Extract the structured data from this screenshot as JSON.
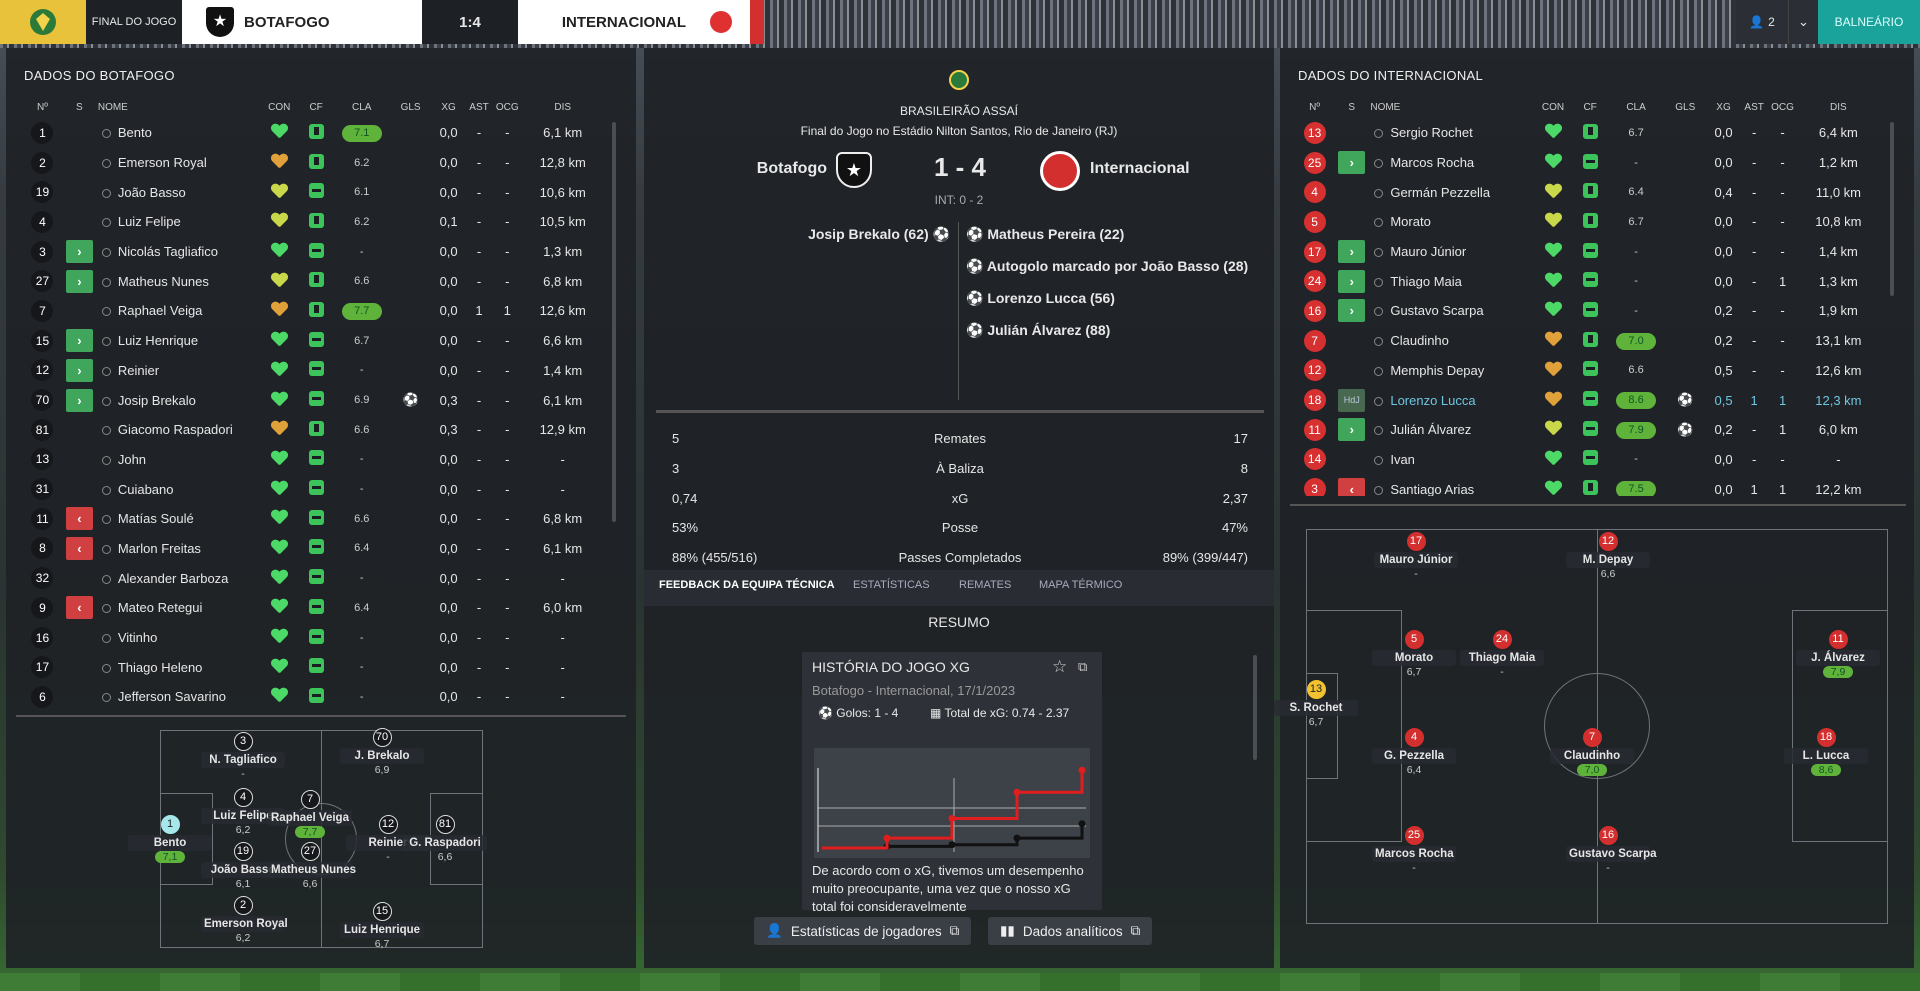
{
  "header": {
    "status": "FINAL DO JOGO",
    "home": "BOTAFOGO",
    "score": "1:4",
    "away": "INTERNACIONAL",
    "user_count": "2",
    "dressing_room": "BALNEÁRIO"
  },
  "colors": {
    "accent": "#1aa39a",
    "rating_green": "#5fb33a",
    "sub_in": "#3fa65c",
    "sub_out": "#d04040",
    "inter_red": "#d42f2f"
  },
  "icons": {
    "league": "brasileirao-icon",
    "person": "user-icon",
    "chevron": "chevron-down-icon",
    "goal": "ball-icon",
    "star": "star-icon",
    "external": "external-link-icon",
    "chart": "bar-chart-icon"
  },
  "columns": {
    "no": "Nº",
    "s": "S",
    "name": "NOME",
    "con": "CON",
    "cf": "CF",
    "cla": "CLA",
    "gls": "GLS",
    "xg": "XG",
    "ast": "AST",
    "ocg": "OCG",
    "dis": "DIS"
  },
  "botafogo": {
    "title": "DADOS DO BOTAFOGO",
    "players": [
      {
        "no": "1",
        "s": "",
        "name": "Bento",
        "con": "g",
        "cf": "u",
        "cla": "7.1",
        "cg": true,
        "gls": "",
        "xg": "0,0",
        "ast": "-",
        "ocg": "-",
        "dis": "6,1 km",
        "dim": false
      },
      {
        "no": "2",
        "s": "",
        "name": "Emerson Royal",
        "con": "o",
        "cf": "u",
        "cla": "6.2",
        "cg": false,
        "gls": "",
        "xg": "0,0",
        "ast": "-",
        "ocg": "-",
        "dis": "12,8 km",
        "dim": false
      },
      {
        "no": "19",
        "s": "",
        "name": "João Basso",
        "con": "y",
        "cf": "m",
        "cla": "6.1",
        "cg": false,
        "gls": "",
        "xg": "0,0",
        "ast": "-",
        "ocg": "-",
        "dis": "10,6 km",
        "dim": false
      },
      {
        "no": "4",
        "s": "",
        "name": "Luiz Felipe",
        "con": "y",
        "cf": "u",
        "cla": "6.2",
        "cg": false,
        "gls": "",
        "xg": "0,1",
        "ast": "-",
        "ocg": "-",
        "dis": "10,5 km",
        "dim": false
      },
      {
        "no": "3",
        "s": "in",
        "name": "Nicolás Tagliafico",
        "con": "g",
        "cf": "m",
        "cla": "-",
        "cg": false,
        "gls": "",
        "xg": "0,0",
        "ast": "-",
        "ocg": "-",
        "dis": "1,3 km",
        "dim": false
      },
      {
        "no": "27",
        "s": "in",
        "name": "Matheus Nunes",
        "con": "y",
        "cf": "u",
        "cla": "6.6",
        "cg": false,
        "gls": "",
        "xg": "0,0",
        "ast": "-",
        "ocg": "-",
        "dis": "6,8 km",
        "dim": false
      },
      {
        "no": "7",
        "s": "",
        "name": "Raphael Veiga",
        "con": "o",
        "cf": "u",
        "cla": "7.7",
        "cg": true,
        "gls": "",
        "xg": "0,0",
        "ast": "1",
        "ocg": "1",
        "dis": "12,6 km",
        "dim": false
      },
      {
        "no": "15",
        "s": "in",
        "name": "Luiz Henrique",
        "con": "g",
        "cf": "m",
        "cla": "6.7",
        "cg": false,
        "gls": "",
        "xg": "0,0",
        "ast": "-",
        "ocg": "-",
        "dis": "6,6 km",
        "dim": false
      },
      {
        "no": "12",
        "s": "in",
        "name": "Reinier",
        "con": "g",
        "cf": "m",
        "cla": "-",
        "cg": false,
        "gls": "",
        "xg": "0,0",
        "ast": "-",
        "ocg": "-",
        "dis": "1,4 km",
        "dim": false
      },
      {
        "no": "70",
        "s": "in",
        "name": "Josip Brekalo",
        "con": "g",
        "cf": "m",
        "cla": "6.9",
        "cg": false,
        "gls": "ball",
        "xg": "0,3",
        "ast": "-",
        "ocg": "-",
        "dis": "6,1 km",
        "dim": false
      },
      {
        "no": "81",
        "s": "",
        "name": "Giacomo Raspadori",
        "con": "o",
        "cf": "u",
        "cla": "6.6",
        "cg": false,
        "gls": "",
        "xg": "0,3",
        "ast": "-",
        "ocg": "-",
        "dis": "12,9 km",
        "dim": false
      },
      {
        "no": "13",
        "s": "",
        "name": "John",
        "con": "g",
        "cf": "m",
        "cla": "-",
        "cg": false,
        "gls": "",
        "xg": "0,0",
        "ast": "-",
        "ocg": "-",
        "dis": "-",
        "dim": true
      },
      {
        "no": "31",
        "s": "",
        "name": "Cuiabano",
        "con": "g",
        "cf": "m",
        "cla": "-",
        "cg": false,
        "gls": "",
        "xg": "0,0",
        "ast": "-",
        "ocg": "-",
        "dis": "-",
        "dim": true
      },
      {
        "no": "11",
        "s": "out",
        "name": "Matías Soulé",
        "con": "g",
        "cf": "m",
        "cla": "6.6",
        "cg": false,
        "gls": "",
        "xg": "0,0",
        "ast": "-",
        "ocg": "-",
        "dis": "6,8 km",
        "dim": true
      },
      {
        "no": "8",
        "s": "out",
        "name": "Marlon Freitas",
        "con": "g",
        "cf": "m",
        "cla": "6.4",
        "cg": false,
        "gls": "",
        "xg": "0,0",
        "ast": "-",
        "ocg": "-",
        "dis": "6,1 km",
        "dim": true
      },
      {
        "no": "32",
        "s": "",
        "name": "Alexander Barboza",
        "con": "g",
        "cf": "m",
        "cla": "-",
        "cg": false,
        "gls": "",
        "xg": "0,0",
        "ast": "-",
        "ocg": "-",
        "dis": "-",
        "dim": true
      },
      {
        "no": "9",
        "s": "out",
        "name": "Mateo Retegui",
        "con": "g",
        "cf": "m",
        "cla": "6.4",
        "cg": false,
        "gls": "",
        "xg": "0,0",
        "ast": "-",
        "ocg": "-",
        "dis": "6,0 km",
        "dim": true
      },
      {
        "no": "16",
        "s": "",
        "name": "Vitinho",
        "con": "g",
        "cf": "m",
        "cla": "-",
        "cg": false,
        "gls": "",
        "xg": "0,0",
        "ast": "-",
        "ocg": "-",
        "dis": "-",
        "dim": true
      },
      {
        "no": "17",
        "s": "",
        "name": "Thiago Heleno",
        "con": "g",
        "cf": "m",
        "cla": "-",
        "cg": false,
        "gls": "",
        "xg": "0,0",
        "ast": "-",
        "ocg": "-",
        "dis": "-",
        "dim": true
      },
      {
        "no": "6",
        "s": "",
        "name": "Jefferson Savarino",
        "con": "g",
        "cf": "m",
        "cla": "-",
        "cg": false,
        "gls": "",
        "xg": "0,0",
        "ast": "-",
        "ocg": "-",
        "dis": "-",
        "dim": true
      }
    ]
  },
  "internacional": {
    "title": "DADOS DO INTERNACIONAL",
    "players": [
      {
        "no": "13",
        "s": "",
        "name": "Sergio Rochet",
        "con": "g",
        "cf": "u",
        "cla": "6.7",
        "cg": false,
        "gls": "",
        "xg": "0,0",
        "ast": "-",
        "ocg": "-",
        "dis": "6,4 km",
        "dim": false
      },
      {
        "no": "25",
        "s": "in",
        "name": "Marcos Rocha",
        "con": "g",
        "cf": "m",
        "cla": "-",
        "cg": false,
        "gls": "",
        "xg": "0,0",
        "ast": "-",
        "ocg": "-",
        "dis": "1,2 km",
        "dim": false
      },
      {
        "no": "4",
        "s": "",
        "name": "Germán Pezzella",
        "con": "y",
        "cf": "u",
        "cla": "6.4",
        "cg": false,
        "gls": "",
        "xg": "0,4",
        "ast": "-",
        "ocg": "-",
        "dis": "11,0 km",
        "dim": false
      },
      {
        "no": "5",
        "s": "",
        "name": "Morato",
        "con": "y",
        "cf": "u",
        "cla": "6.7",
        "cg": false,
        "gls": "",
        "xg": "0,0",
        "ast": "-",
        "ocg": "-",
        "dis": "10,8 km",
        "dim": false
      },
      {
        "no": "17",
        "s": "in",
        "name": "Mauro Júnior",
        "con": "g",
        "cf": "m",
        "cla": "-",
        "cg": false,
        "gls": "",
        "xg": "0,0",
        "ast": "-",
        "ocg": "-",
        "dis": "1,4 km",
        "dim": false
      },
      {
        "no": "24",
        "s": "in",
        "name": "Thiago Maia",
        "con": "g",
        "cf": "m",
        "cla": "-",
        "cg": false,
        "gls": "",
        "xg": "0,0",
        "ast": "-",
        "ocg": "1",
        "dis": "1,3 km",
        "dim": false
      },
      {
        "no": "16",
        "s": "in",
        "name": "Gustavo Scarpa",
        "con": "g",
        "cf": "m",
        "cla": "-",
        "cg": false,
        "gls": "",
        "xg": "0,2",
        "ast": "-",
        "ocg": "-",
        "dis": "1,9 km",
        "dim": false
      },
      {
        "no": "7",
        "s": "",
        "name": "Claudinho",
        "con": "o",
        "cf": "u",
        "cla": "7.0",
        "cg": true,
        "gls": "",
        "xg": "0,2",
        "ast": "-",
        "ocg": "-",
        "dis": "13,1 km",
        "dim": false
      },
      {
        "no": "12",
        "s": "",
        "name": "Memphis Depay",
        "con": "o",
        "cf": "m",
        "cla": "6.6",
        "cg": false,
        "gls": "",
        "xg": "0,5",
        "ast": "-",
        "ocg": "-",
        "dis": "12,6 km",
        "dim": false
      },
      {
        "no": "18",
        "s": "hdj",
        "name": "Lorenzo Lucca",
        "con": "o",
        "cf": "m",
        "cla": "8.6",
        "cg": true,
        "gls": "ball",
        "xg": "0,5",
        "ast": "1",
        "ocg": "1",
        "dis": "12,3 km",
        "dim": false,
        "hl": true
      },
      {
        "no": "11",
        "s": "in",
        "name": "Julián Álvarez",
        "con": "y",
        "cf": "m",
        "cla": "7.9",
        "cg": true,
        "gls": "ball",
        "xg": "0,2",
        "ast": "-",
        "ocg": "1",
        "dis": "6,0 km",
        "dim": false
      },
      {
        "no": "14",
        "s": "",
        "name": "Ivan",
        "con": "g",
        "cf": "m",
        "cla": "-",
        "cg": false,
        "gls": "",
        "xg": "0,0",
        "ast": "-",
        "ocg": "-",
        "dis": "-",
        "dim": true
      },
      {
        "no": "3",
        "s": "out",
        "name": "Santiago Arias",
        "con": "g",
        "cf": "u",
        "cla": "7.5",
        "cg": true,
        "gls": "",
        "xg": "0,0",
        "ast": "1",
        "ocg": "1",
        "dis": "12,2 km",
        "dim": true
      }
    ]
  },
  "match": {
    "competition": "BRASILEIRÃO ASSAÍ",
    "subtitle": "Final do Jogo no Estádio Nilton Santos, Rio de Janeiro (RJ)",
    "home": "Botafogo",
    "away": "Internacional",
    "score": "1 - 4",
    "halftime": "INT: 0 - 2",
    "home_goals": [
      "Josip Brekalo (62)"
    ],
    "away_goals": [
      "Matheus Pereira (22)",
      "Autogolo marcado por João Basso (28)",
      "Lorenzo Lucca (56)",
      "Julián Álvarez (88)"
    ]
  },
  "stats": [
    {
      "home": "5",
      "label": "Remates",
      "away": "17"
    },
    {
      "home": "3",
      "label": "À Baliza",
      "away": "8"
    },
    {
      "home": "0,74",
      "label": "xG",
      "away": "2,37"
    },
    {
      "home": "53%",
      "label": "Posse",
      "away": "47%"
    },
    {
      "home": "88% (455/516)",
      "label": "Passes Completados",
      "away": "89% (399/447)"
    }
  ],
  "tabs": [
    "FEEDBACK DA EQUIPA TÉCNICA",
    "ESTATÍSTICAS",
    "REMATES",
    "MAPA TÉRMICO"
  ],
  "summary": {
    "heading": "RESUMO",
    "card_title": "HISTÓRIA DO JOGO XG",
    "card_sub": "Botafogo - Internacional, 17/1/2023",
    "goals": "Golos: 1 - 4",
    "xg_total": "Total de xG: 0.74 - 2.37",
    "text": "De acordo com o xG, tivemos um desempenho muito preocupante, uma vez que o nosso xG total foi consideravelmente"
  },
  "buttons": {
    "players": "Estatísticas de jogadores",
    "analytics": "Dados analíticos"
  },
  "chart_data": {
    "type": "line",
    "title": "",
    "series": [
      {
        "name": "Botafogo",
        "values": [
          0,
          0.05,
          0.1,
          0.3,
          0.74
        ]
      },
      {
        "name": "Internacional",
        "values": [
          0,
          0.3,
          0.9,
          1.7,
          2.37
        ]
      }
    ]
  },
  "bota_pitch": [
    {
      "no": "1",
      "name": "Bento",
      "r": "7,1",
      "g": true,
      "c": "nc"
    },
    {
      "no": "3",
      "name": "N. Tagliafico",
      "r": "-",
      "g": false,
      "c": ""
    },
    {
      "no": "4",
      "name": "Luiz Felipe",
      "r": "6,2",
      "g": false,
      "c": ""
    },
    {
      "no": "19",
      "name": "João Basso",
      "r": "6,1",
      "g": false,
      "c": ""
    },
    {
      "no": "2",
      "name": "Emerson Royal",
      "r": "6,2",
      "g": false,
      "c": ""
    },
    {
      "no": "7",
      "name": "Raphael Veiga",
      "r": "7,7",
      "g": true,
      "c": ""
    },
    {
      "no": "27",
      "name": "Matheus Nunes",
      "r": "6,6",
      "g": false,
      "c": ""
    },
    {
      "no": "70",
      "name": "J. Brekalo",
      "r": "6,9",
      "g": false,
      "c": ""
    },
    {
      "no": "12",
      "name": "Reinier",
      "r": "-",
      "g": false,
      "c": ""
    },
    {
      "no": "15",
      "name": "Luiz Henrique",
      "r": "6,7",
      "g": false,
      "c": ""
    },
    {
      "no": "81",
      "name": "G. Raspadori",
      "r": "6,6",
      "g": false,
      "c": ""
    }
  ],
  "inter_pitch": [
    {
      "no": "13",
      "name": "S. Rochet",
      "r": "6,7",
      "g": false,
      "c": "ny"
    },
    {
      "no": "17",
      "name": "Mauro Júnior",
      "r": "-",
      "g": false,
      "c": "nr"
    },
    {
      "no": "12",
      "name": "M. Depay",
      "r": "6,6",
      "g": false,
      "c": "nr"
    },
    {
      "no": "5",
      "name": "Morato",
      "r": "6,7",
      "g": false,
      "c": "nr"
    },
    {
      "no": "24",
      "name": "Thiago Maia",
      "r": "-",
      "g": false,
      "c": "nr"
    },
    {
      "no": "11",
      "name": "J. Álvarez",
      "r": "7,9",
      "g": true,
      "c": "nr"
    },
    {
      "no": "4",
      "name": "G. Pezzella",
      "r": "6,4",
      "g": false,
      "c": "nr"
    },
    {
      "no": "7",
      "name": "Claudinho",
      "r": "7,0",
      "g": true,
      "c": "nr"
    },
    {
      "no": "18",
      "name": "L. Lucca",
      "r": "8,6",
      "g": true,
      "c": "nr"
    },
    {
      "no": "25",
      "name": "Marcos Rocha",
      "r": "-",
      "g": false,
      "c": "nr"
    },
    {
      "no": "16",
      "name": "Gustavo Scarpa",
      "r": "-",
      "g": false,
      "c": "nr"
    }
  ]
}
